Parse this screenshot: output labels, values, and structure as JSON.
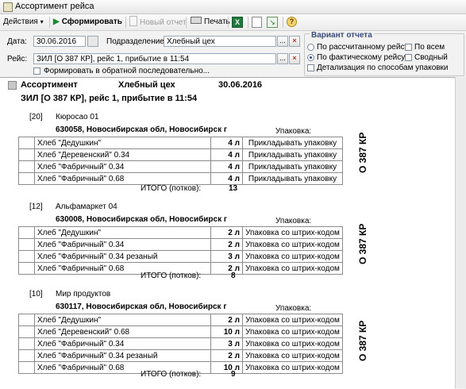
{
  "window": {
    "title": "Ассортимент рейса"
  },
  "toolbar": {
    "actions_label": "Действия",
    "generate_label": "Сформировать",
    "new_report_label": "Новый отчет",
    "print_label": "Печать",
    "help_label": "?"
  },
  "form": {
    "date_label": "Дата:",
    "date_value": "30.06.2016",
    "division_label": "Подразделение:",
    "division_value": "Хлебный цех",
    "trip_label": "Рейс:",
    "trip_value": "ЗИЛ [О 387 КР], рейс 1, прибытие в 11:54",
    "reverse_label": "Формировать в обратной последовательно...",
    "dots": "...",
    "clear": "×"
  },
  "variant": {
    "title": "Вариант отчета",
    "opt_calculated": "По рассчитанному рейсу",
    "opt_actual": "По фактическому рейсу",
    "opt_all": "По всем",
    "opt_summary": "Сводный",
    "opt_detail": "Детализация по способам упаковки"
  },
  "report": {
    "head_title": "Ассортимент",
    "head_division": "Хлебный цех",
    "head_date": "30.06.2016",
    "trip_line": "ЗИЛ [О 387 КР], рейс 1, прибытие в 11:54",
    "pack_header": "Упаковка:",
    "total_label": "ИТОГО (потков):",
    "vehicle": "О 387 КР",
    "stores": [
      {
        "code": "[20]",
        "name": "Кюросао 01",
        "address": "630058, Новосибирская обл, Новосибирск г",
        "rows": [
          {
            "name": "Хлеб \"Дедушкин\"",
            "qty": "4 л",
            "pack": "Прикладывать упаковку"
          },
          {
            "name": "Хлеб \"Деревенский\" 0.34",
            "qty": "4 л",
            "pack": "Прикладывать упаковку"
          },
          {
            "name": "Хлеб \"Фабричный\" 0.34",
            "qty": "4 л",
            "pack": "Прикладывать упаковку"
          },
          {
            "name": "Хлеб \"Фабричный\" 0.68",
            "qty": "4 л",
            "pack": "Прикладывать упаковку"
          }
        ],
        "total": "13"
      },
      {
        "code": "[12]",
        "name": "Альфамаркет 04",
        "address": "630008, Новосибирская обл, Новосибирск г",
        "rows": [
          {
            "name": "Хлеб \"Дедушкин\"",
            "qty": "2 л",
            "pack": "Упаковка со штрих-кодом"
          },
          {
            "name": "Хлеб \"Фабричный\" 0.34",
            "qty": "2 л",
            "pack": "Упаковка со штрих-кодом"
          },
          {
            "name": "Хлеб \"Фабричный\" 0.34 резаный",
            "qty": "3 л",
            "pack": "Упаковка со штрих-кодом"
          },
          {
            "name": "Хлеб \"Фабричный\" 0.68",
            "qty": "2 л",
            "pack": "Упаковка со штрих-кодом"
          }
        ],
        "total": "8"
      },
      {
        "code": "[10]",
        "name": "Мир продуктов",
        "address": "630117, Новосибирская обл, Новосибирск г",
        "rows": [
          {
            "name": "Хлеб \"Дедушкин\"",
            "qty": "2 л",
            "pack": "Упаковка со штрих-кодом"
          },
          {
            "name": "Хлеб \"Деревенский\" 0.68",
            "qty": "10 л",
            "pack": "Упаковка со штрих-кодом"
          },
          {
            "name": "Хлеб \"Фабричный\" 0.34",
            "qty": "3 л",
            "pack": "Упаковка со штрих-кодом"
          },
          {
            "name": "Хлеб \"Фабричный\" 0.34 резаный",
            "qty": "2 л",
            "pack": "Упаковка со штрих-кодом"
          },
          {
            "name": "Хлеб \"Фабричный\" 0.68",
            "qty": "10 л",
            "pack": "Упаковка со штрих-кодом"
          }
        ],
        "total": "9"
      }
    ]
  },
  "colors": {
    "accent_green": "#1c8a2a",
    "title_blue": "#3a4a7a"
  }
}
